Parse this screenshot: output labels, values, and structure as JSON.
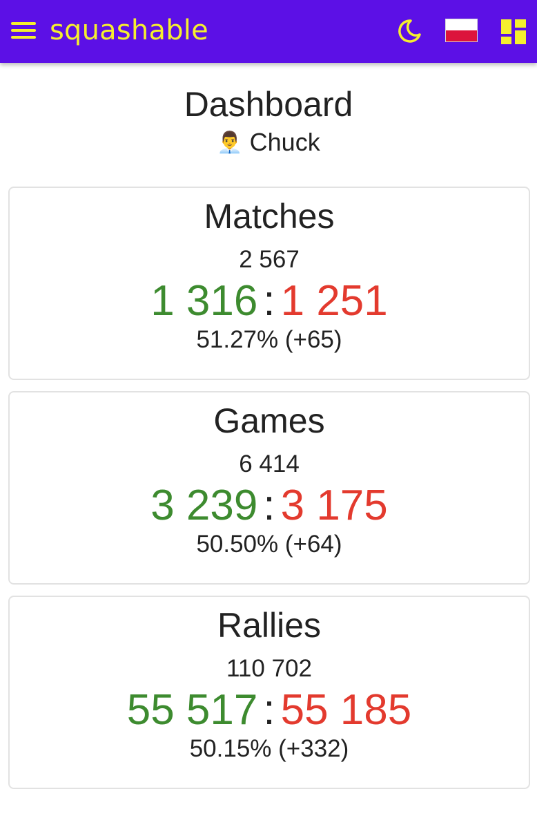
{
  "app": {
    "title": "squashable",
    "colors": {
      "bar": "#5c10e6",
      "accent": "#f5ef2e",
      "win": "#3d8b2f",
      "loss": "#e33a2e"
    },
    "icons": [
      "menu-icon",
      "moon-icon",
      "poland-flag-icon",
      "dashboard-icon"
    ]
  },
  "header": {
    "title": "Dashboard",
    "user_icon": "👨‍💼",
    "user_name": "Chuck"
  },
  "stats": [
    {
      "title": "Matches",
      "total": "2 567",
      "wins": "1 316",
      "losses": "1 251",
      "separator": ":",
      "summary": "51.27% (+65)"
    },
    {
      "title": "Games",
      "total": "6 414",
      "wins": "3 239",
      "losses": "3 175",
      "separator": ":",
      "summary": "50.50% (+64)"
    },
    {
      "title": "Rallies",
      "total": "110 702",
      "wins": "55 517",
      "losses": "55 185",
      "separator": ":",
      "summary": "50.15% (+332)"
    }
  ]
}
